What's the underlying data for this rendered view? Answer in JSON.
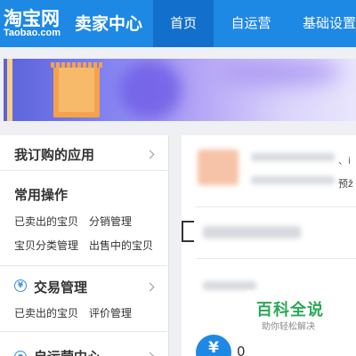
{
  "header": {
    "logo_text": "淘宝网",
    "logo_sub": "Taobao.com",
    "center_title": "卖家中心",
    "tabs": [
      {
        "label": "首页",
        "active": true
      },
      {
        "label": "自运营",
        "active": false
      },
      {
        "label": "基础设置",
        "active": false
      }
    ],
    "accent_color": "#1e88e5"
  },
  "sidebar": {
    "my_apps_label": "我订购的应用",
    "common_ops_title": "常用操作",
    "common_ops_links": [
      "已卖出的宝贝",
      "分销管理",
      "宝贝分类管理",
      "出售中的宝贝"
    ],
    "trade_title": "交易管理",
    "trade_links": [
      "已卖出的宝贝",
      "评价管理"
    ],
    "self_ops_title": "自运营中心"
  },
  "main": {
    "close_text": "、i",
    "pre_text": "预ž",
    "stat_value": "0"
  },
  "watermark": {
    "title": "百科全说",
    "subtitle": "助你轻松解决",
    "color": "#2aa857"
  }
}
